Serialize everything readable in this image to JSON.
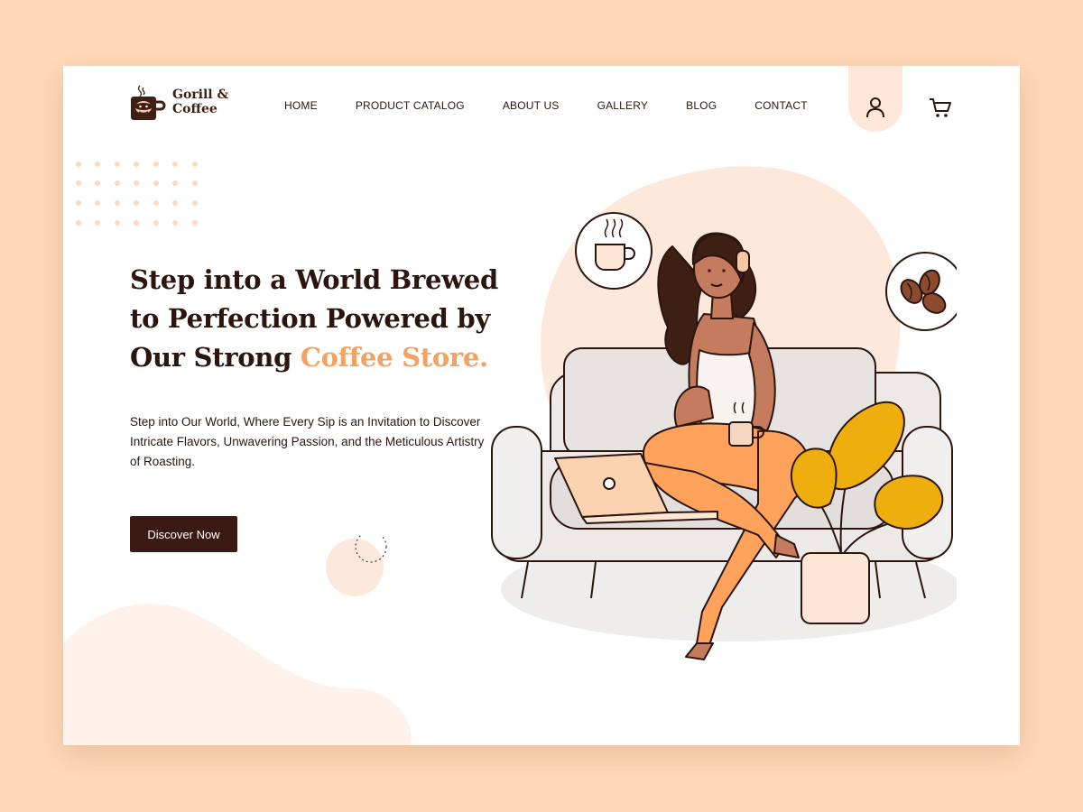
{
  "brand": {
    "line1": "Gorill &",
    "line2": "Coffee"
  },
  "nav": {
    "items": [
      "HOME",
      "PRODUCT CATALOG",
      "ABOUT US",
      "GALLERY",
      "BLOG",
      "CONTACT"
    ]
  },
  "hero": {
    "headline_line1": "Step into a World Brewed",
    "headline_line2": "to Perfection Powered by",
    "headline_line3_prefix": "Our Strong ",
    "headline_line3_accent": "Coffee Store.",
    "subtext": "Step into Our World, Where Every Sip is an Invitation to Discover Intricate Flavors, Unwavering Passion, and the Meticulous Artistry of Roasting.",
    "cta_label": "Discover Now"
  },
  "icons": {
    "user": "user-icon",
    "cart": "cart-icon",
    "cup": "coffee-cup-icon",
    "beans": "coffee-beans-icon"
  },
  "colors": {
    "page_background": "#FFD9B9",
    "card_background": "#FFFFFF",
    "primary_dark": "#3A1A12",
    "text": "#2B150E",
    "accent": "#F2A261",
    "soft_peach": "#FDE7D8"
  }
}
